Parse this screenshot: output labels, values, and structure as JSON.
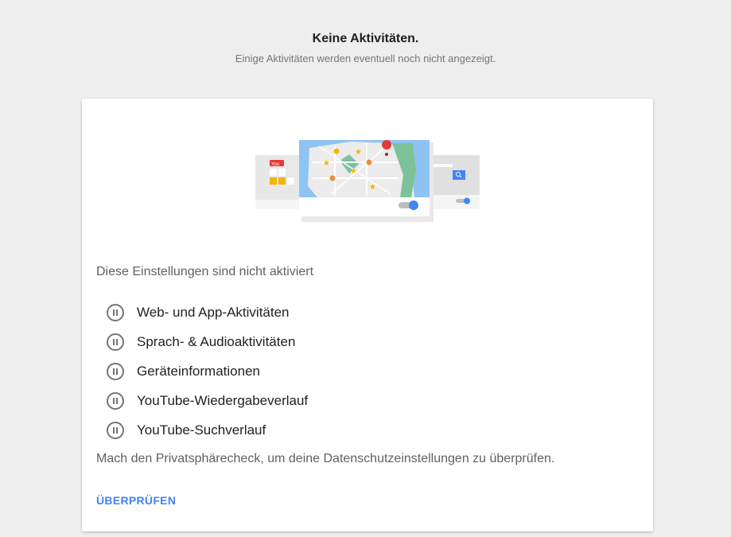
{
  "header": {
    "title": "Keine Aktivitäten.",
    "subtitle": "Einige Aktivitäten werden eventuell noch nicht angezeigt."
  },
  "card": {
    "intro": "Diese Einstellungen sind nicht aktiviert",
    "settings": [
      {
        "label": "Web- und App-Aktivitäten",
        "icon": "pause-circle-icon"
      },
      {
        "label": "Sprach- & Audioaktivitäten",
        "icon": "pause-circle-icon"
      },
      {
        "label": "Geräteinformationen",
        "icon": "pause-circle-icon"
      },
      {
        "label": "YouTube-Wiedergabeverlauf",
        "icon": "pause-circle-icon"
      },
      {
        "label": "YouTube-Suchverlauf",
        "icon": "pause-circle-icon"
      }
    ],
    "privacy_text": "Mach den Privatsphärecheck, um deine Datenschutzeinstellungen zu überprüfen.",
    "review_label": "ÜBERPRÜFEN",
    "illustration": {
      "youtube_logo": "You"
    }
  },
  "colors": {
    "accent": "#4285f4",
    "background": "#eeeeee",
    "icon_gray": "#757575"
  }
}
